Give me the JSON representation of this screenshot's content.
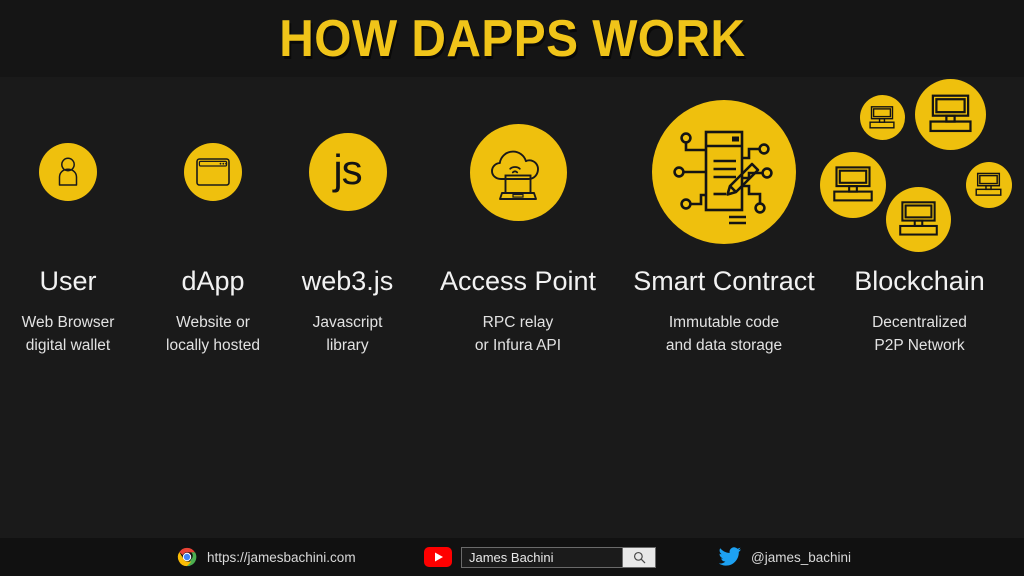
{
  "header": {
    "title": "HOW DAPPS WORK",
    "title_color": "#F0C419",
    "band_color": "#151515"
  },
  "theme": {
    "background": "#1a1a1a",
    "accent_yellow": "#EFC00D",
    "text_primary": "#f2f2f2",
    "text_secondary": "#e2e2e2",
    "twitter_blue": "#1DA1F2",
    "youtube_red": "#FF0000"
  },
  "flow": {
    "steps": [
      {
        "id": "user",
        "label": "User",
        "desc_line1": "Web Browser",
        "desc_line2": "digital wallet",
        "icon": "person-icon"
      },
      {
        "id": "dapp",
        "label": "dApp",
        "desc_line1": "Website or",
        "desc_line2": "locally hosted",
        "icon": "browser-window-icon"
      },
      {
        "id": "web3js",
        "label": "web3.js",
        "desc_line1": "Javascript",
        "desc_line2": "library",
        "icon": "js-text-icon",
        "icon_text": "js"
      },
      {
        "id": "access-point",
        "label": "Access Point",
        "desc_line1": "RPC relay",
        "desc_line2": "or Infura API",
        "icon": "cloud-computer-icon"
      },
      {
        "id": "smart-contract",
        "label": "Smart Contract",
        "desc_line1": "Immutable code",
        "desc_line2": "and data storage",
        "icon": "contract-circuit-icon"
      },
      {
        "id": "blockchain",
        "label": "Blockchain",
        "desc_line1": "Decentralized",
        "desc_line2": "P2P Network",
        "icon": "network-nodes-icon"
      }
    ]
  },
  "footer": {
    "website": {
      "icon": "chrome-icon",
      "url": "https://jamesbachini.com"
    },
    "youtube": {
      "icon": "youtube-icon",
      "search_value": "James Bachini",
      "search_icon": "search-icon"
    },
    "twitter": {
      "icon": "twitter-bird-icon",
      "handle": "@james_bachini"
    }
  }
}
